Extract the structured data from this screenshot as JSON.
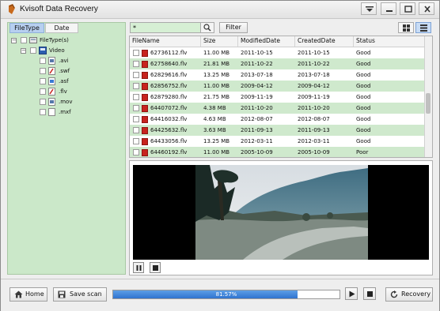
{
  "window": {
    "title": "Kvisoft Data Recovery",
    "icons": [
      "app-icon",
      "menu-icon",
      "minimize-icon",
      "restore-icon",
      "close-icon"
    ]
  },
  "sidebar": {
    "tabs": [
      {
        "label": "FileType",
        "active": true
      },
      {
        "label": "Date",
        "active": false
      }
    ],
    "tree": {
      "root": "FileType(s)",
      "group": "Video",
      "items": [
        ".avi",
        ".swf",
        ".asf",
        ".flv",
        ".mov",
        ".mxf"
      ]
    }
  },
  "search": {
    "value": "*",
    "filter_label": "Filter"
  },
  "table": {
    "columns": [
      "FileName",
      "Size",
      "ModifiedDate",
      "CreatedDate",
      "Status"
    ],
    "rows": [
      {
        "name": "62736112.flv",
        "size": "11.00 MB",
        "modified": "2011-10-15",
        "created": "2011-10-15",
        "status": "Good"
      },
      {
        "name": "62758640.flv",
        "size": "21.81 MB",
        "modified": "2011-10-22",
        "created": "2011-10-22",
        "status": "Good"
      },
      {
        "name": "62829616.flv",
        "size": "13.25 MB",
        "modified": "2013-07-18",
        "created": "2013-07-18",
        "status": "Good"
      },
      {
        "name": "62856752.flv",
        "size": "11.00 MB",
        "modified": "2009-04-12",
        "created": "2009-04-12",
        "status": "Good"
      },
      {
        "name": "62879280.flv",
        "size": "21.75 MB",
        "modified": "2009-11-19",
        "created": "2009-11-19",
        "status": "Good"
      },
      {
        "name": "64407072.flv",
        "size": "4.38 MB",
        "modified": "2011-10-20",
        "created": "2011-10-20",
        "status": "Good"
      },
      {
        "name": "64416032.flv",
        "size": "4.63 MB",
        "modified": "2012-08-07",
        "created": "2012-08-07",
        "status": "Good"
      },
      {
        "name": "64425632.flv",
        "size": "3.63 MB",
        "modified": "2011-09-13",
        "created": "2011-09-13",
        "status": "Good"
      },
      {
        "name": "64433056.flv",
        "size": "13.25 MB",
        "modified": "2012-03-11",
        "created": "2012-03-11",
        "status": "Good"
      },
      {
        "name": "64460192.flv",
        "size": "11.00 MB",
        "modified": "2005-10-09",
        "created": "2005-10-09",
        "status": "Poor"
      }
    ]
  },
  "preview": {
    "icons": [
      "pause-icon",
      "stop-icon"
    ]
  },
  "footer": {
    "home_label": "Home",
    "save_label": "Save scan",
    "progress_text": "81.57%",
    "progress_value": 81.57,
    "recovery_label": "Recovery",
    "icons": [
      "home-icon",
      "save-icon",
      "play-icon",
      "stop-icon",
      "recovery-icon"
    ]
  },
  "colors": {
    "accent": "#3a80d6",
    "panel": "#cbe8c9",
    "row_alt": "#cfe9cd",
    "flv_icon": "#c8231e"
  }
}
